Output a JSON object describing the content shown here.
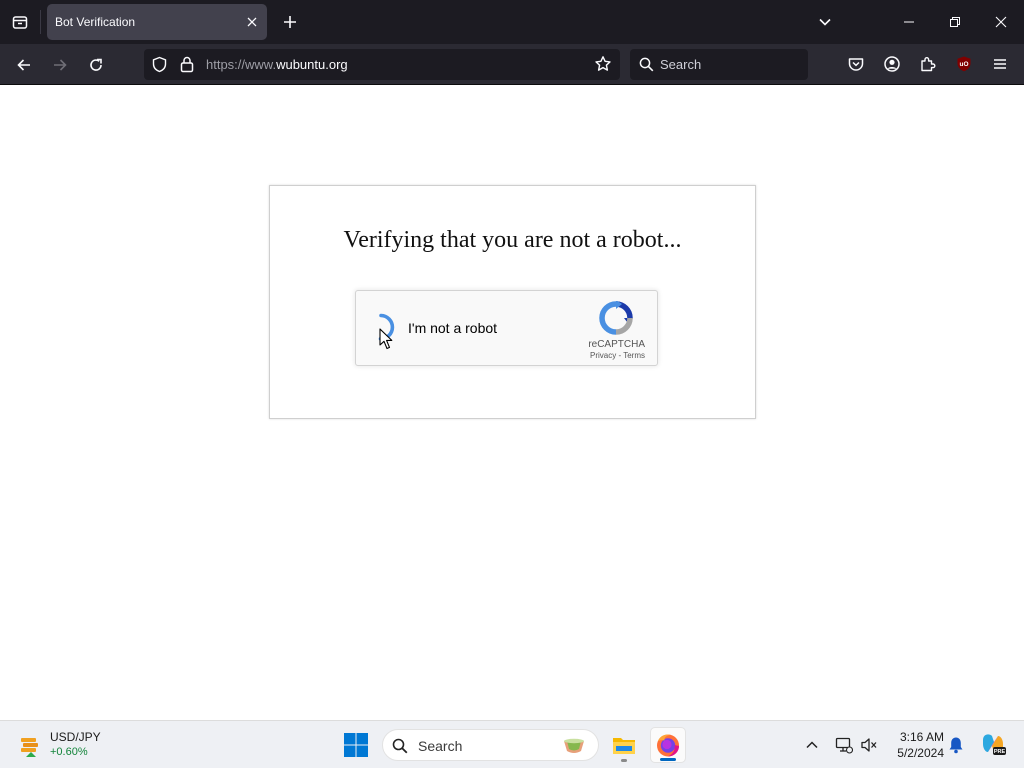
{
  "browser": {
    "tab_title": "Bot Verification",
    "url_prefix": "https://www.",
    "url_host": "wubuntu.org",
    "search_placeholder": "Search"
  },
  "page": {
    "heading": "Verifying that you are not a robot...",
    "recaptcha": {
      "label": "I'm not a robot",
      "brand": "reCAPTCHA",
      "privacy_link": "Privacy",
      "separator": " - ",
      "terms_link": "Terms"
    }
  },
  "taskbar": {
    "widget": {
      "title": "USD/JPY",
      "change": "+0.60%",
      "change_color": "#13843a"
    },
    "search_placeholder": "Search",
    "apps": [
      "file-explorer",
      "firefox"
    ],
    "clock": {
      "time": "3:16 AM",
      "date": "5/2/2024"
    }
  },
  "colors": {
    "chrome_dark": "#1c1b22",
    "toolbar": "#2b2a33",
    "recaptcha_blue": "#4a90e2",
    "ublock_red": "#800000",
    "windows_blue": "#0078d4"
  }
}
